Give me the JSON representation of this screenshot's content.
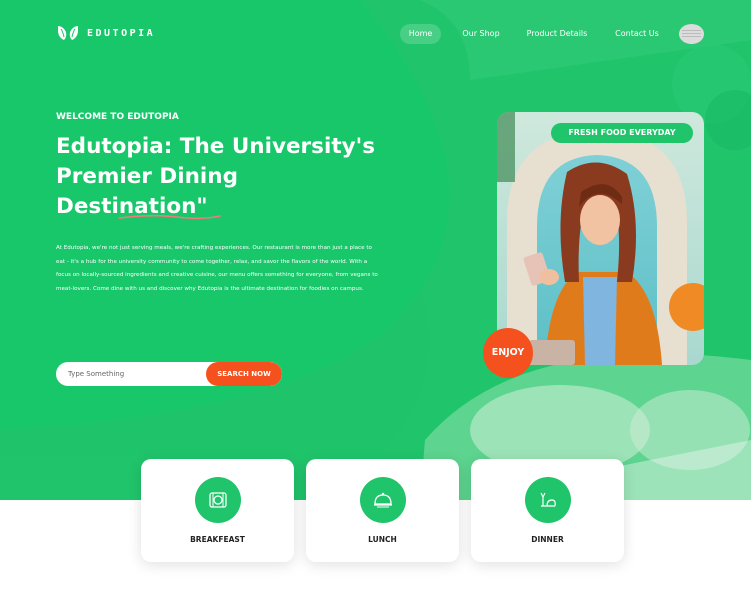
{
  "brand": {
    "name": "EDUTOPIA"
  },
  "nav": {
    "items": [
      {
        "label": "Home",
        "active": true
      },
      {
        "label": "Our Shop"
      },
      {
        "label": "Product Details"
      },
      {
        "label": "Contact Us"
      }
    ]
  },
  "hero": {
    "eyebrow": "WELCOME TO EDUTOPIA",
    "headline_line1": "Edutopia: The University's",
    "headline_line2": "Premier Dining",
    "headline_line3": "Destination\"",
    "intro": "At Edutopia, we're not just serving meals, we're crafting experiences. Our restaurant is more than just a place to eat - it's a hub for the university community to come together, relax, and savor the flavors of the world. With a focus on locally-sourced ingredients and creative cuisine, our menu offers something for everyone, from vegans to meat-lovers. Come dine with us and discover why Edutopia is the ultimate destination for foodies on campus."
  },
  "search": {
    "placeholder": "Type Something",
    "button_label": "SEARCH NOW"
  },
  "badges": {
    "fresh": "FRESH FOOD EVERYDAY",
    "enjoy": "ENJOY"
  },
  "meals": [
    {
      "label": "BREAKFEAST",
      "icon": "breakfast-icon"
    },
    {
      "label": "LUNCH",
      "icon": "lunch-cloche-icon"
    },
    {
      "label": "DINNER",
      "icon": "dinner-icon"
    }
  ],
  "colors": {
    "primary": "#20c46b",
    "accent": "#f4511e",
    "white": "#ffffff"
  }
}
